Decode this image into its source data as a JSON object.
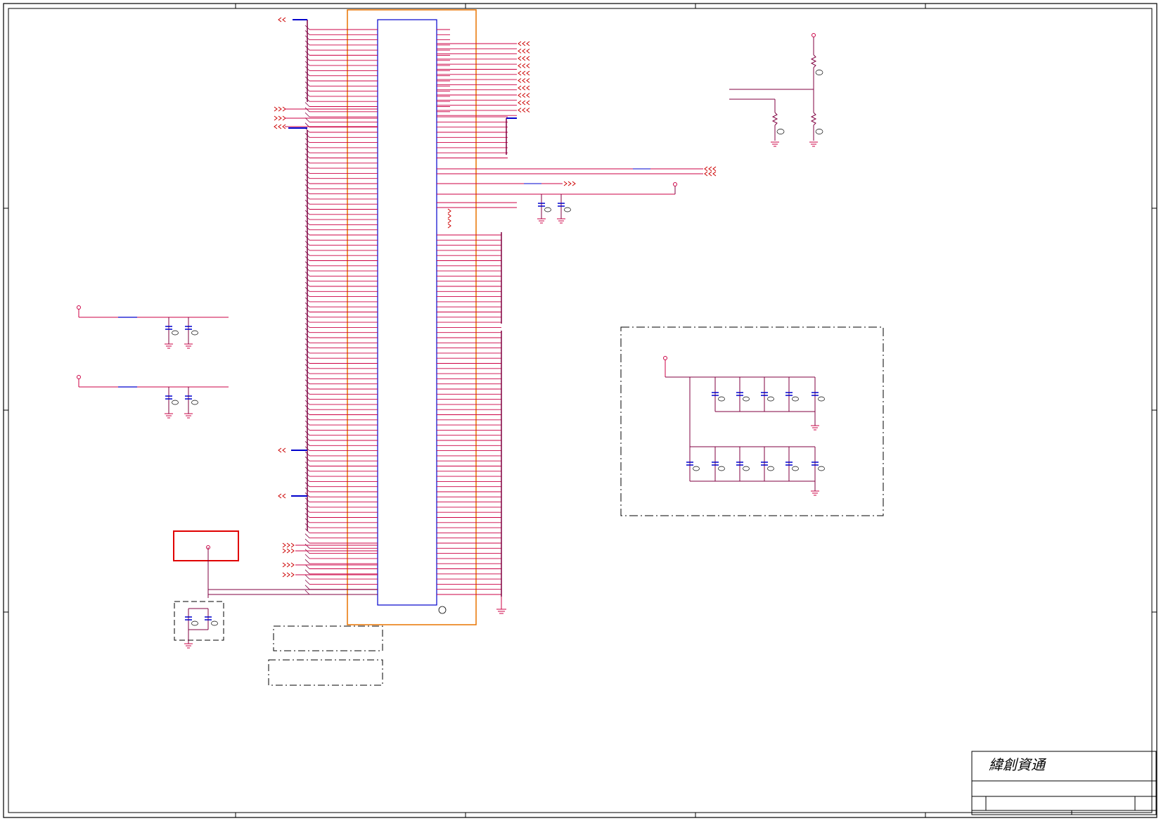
{
  "title_block": {
    "company": "緯創資通"
  },
  "colors": {
    "frame": "#000000",
    "net": "#cc0044",
    "pin": "#cc0000",
    "wire": "#800040",
    "bus": "#0000cc",
    "part_outline": "#e87400",
    "highlight_box": "#e00000",
    "dash_box": "#000000"
  },
  "icons": {
    "offpage_left": "double-chevron-left-icon",
    "offpage_right": "double-chevron-right-icon",
    "ground": "ground-symbol-icon",
    "capacitor": "capacitor-icon",
    "resistor": "resistor-icon",
    "power_pin": "power-pin-icon"
  }
}
